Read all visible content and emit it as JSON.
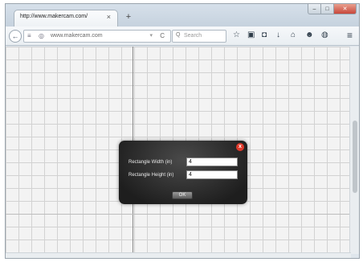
{
  "browser": {
    "tab_title": "http://www.makercam.com/",
    "tab_close": "×",
    "new_tab": "+",
    "window_buttons": {
      "minimize": "–",
      "maximize": "□",
      "close": "✕"
    },
    "url": "www.makercam.com",
    "search_placeholder": "Search"
  },
  "icons": {
    "back": "←",
    "page_info": "≡",
    "globe": "◎",
    "dropdown": "▾",
    "reload": "C",
    "search": "Q",
    "bookmark": "☆",
    "reader": "▣",
    "pocket": "◘",
    "download": "↓",
    "home": "⌂",
    "chat": "☻",
    "avatar": "◍",
    "menu": "≡"
  },
  "dialog": {
    "close": "x",
    "width_label": "Rectangle Width (in)",
    "width_value": "4",
    "height_label": "Rectangle Height (in)",
    "height_value": "4",
    "ok_label": "OK"
  }
}
